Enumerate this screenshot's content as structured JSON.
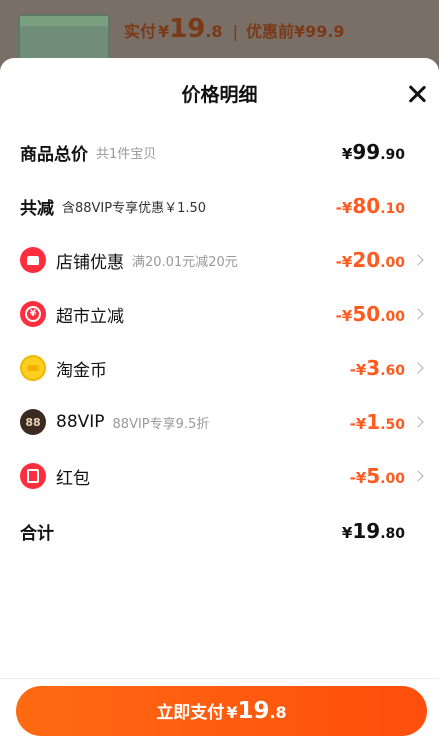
{
  "background": {
    "thumb_caption": "",
    "paid_label": "实付",
    "paid_symbol": "¥",
    "paid_int": "19",
    "paid_dec": ".8",
    "separator": "|",
    "pre_discount": "优惠前¥99.9"
  },
  "sheet": {
    "title": "价格明细",
    "close_icon": "close-icon"
  },
  "rows": {
    "total": {
      "label": "商品总价",
      "sub": "共1件宝贝",
      "sign": "¥",
      "int": "99",
      "dec": ".90"
    },
    "reduction": {
      "label": "共减",
      "sub": "含88VIP专享优惠￥1.50",
      "sign": "-¥",
      "int": "80",
      "dec": ".10"
    },
    "shop": {
      "icon": "shop-icon",
      "label": "店铺优惠",
      "sub": "满20.01元减20元",
      "sign": "-¥",
      "int": "20",
      "dec": ".00"
    },
    "market": {
      "icon": "supermarket-icon",
      "icon_glyph": "¥",
      "label": "超市立减",
      "sub": "",
      "sign": "-¥",
      "int": "50",
      "dec": ".00"
    },
    "coin": {
      "icon": "gold-coin-icon",
      "label": "淘金币",
      "sub": "",
      "sign": "-¥",
      "int": "3",
      "dec": ".60"
    },
    "vip": {
      "icon": "vip-icon",
      "icon_glyph": "88",
      "label": "88VIP",
      "sub": "88VIP专享9.5折",
      "sign": "-¥",
      "int": "1",
      "dec": ".50"
    },
    "redpack": {
      "icon": "red-packet-icon",
      "label": "红包",
      "sub": "",
      "sign": "-¥",
      "int": "5",
      "dec": ".00"
    },
    "sum": {
      "label": "合计",
      "sign": "¥",
      "int": "19",
      "dec": ".80"
    }
  },
  "pay": {
    "label": "立即支付",
    "sign": "¥",
    "int": "19",
    "dec": ".8"
  },
  "colors": {
    "accent": "#ff5a1f",
    "button": "#ff5a12",
    "icon_red": "#ff2e3e",
    "coin": "#ffcf1f"
  }
}
